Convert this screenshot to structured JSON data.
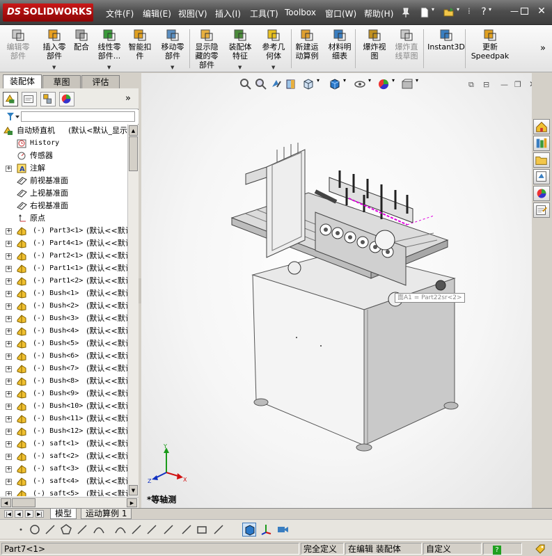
{
  "app": {
    "logo": "SOLIDWORKS",
    "logo_prefix": "DS"
  },
  "menu": [
    "文件(F)",
    "编辑(E)",
    "视图(V)",
    "插入(I)",
    "工具(T)",
    "Toolbox",
    "窗口(W)",
    "帮助(H)"
  ],
  "command_manager": {
    "commands": [
      {
        "label_lines": [
          "编辑零",
          "部件"
        ],
        "disabled": true,
        "icon": "edit-component-icon"
      },
      {
        "label_lines": [
          "插入零",
          "部件"
        ],
        "disabled": false,
        "icon": "insert-component-icon"
      },
      {
        "label_lines": [
          "配合"
        ],
        "disabled": false,
        "icon": "mate-icon"
      },
      {
        "label_lines": [
          "线性零",
          "部件..."
        ],
        "disabled": false,
        "icon": "linear-pattern-icon"
      },
      {
        "label_lines": [
          "智能扣",
          "件"
        ],
        "disabled": false,
        "icon": "smart-fasteners-icon"
      },
      {
        "label_lines": [
          "移动零",
          "部件"
        ],
        "disabled": false,
        "icon": "move-component-icon"
      },
      {
        "label_lines": [
          "显示隐",
          "藏的零",
          "部件"
        ],
        "disabled": false,
        "icon": "show-hidden-icon"
      },
      {
        "label_lines": [
          "装配体",
          "特征"
        ],
        "disabled": false,
        "icon": "assembly-features-icon"
      },
      {
        "label_lines": [
          "参考几",
          "何体"
        ],
        "disabled": false,
        "icon": "reference-geometry-icon"
      },
      {
        "label_lines": [
          "新建运",
          "动算例"
        ],
        "disabled": false,
        "icon": "new-motion-study-icon"
      },
      {
        "label_lines": [
          "材料明",
          "细表"
        ],
        "disabled": false,
        "icon": "bom-icon"
      },
      {
        "label_lines": [
          "爆炸视",
          "图"
        ],
        "disabled": false,
        "icon": "exploded-view-icon"
      },
      {
        "label_lines": [
          "爆炸直",
          "线草图"
        ],
        "disabled": true,
        "icon": "explode-line-sketch-icon"
      },
      {
        "label_lines": [
          "Instant3D"
        ],
        "disabled": false,
        "icon": "instant3d-icon"
      },
      {
        "label_lines": [
          "更新",
          "Speedpak"
        ],
        "disabled": false,
        "icon": "speedpak-icon"
      }
    ],
    "more": "»"
  },
  "left_pane": {
    "tabs": [
      "装配体",
      "草图",
      "评估"
    ],
    "active_tab": "装配体",
    "expand_arrow": "»"
  },
  "tree": {
    "root": {
      "name": "自动矫直机",
      "config": "(默认<默认_显示"
    },
    "items": [
      {
        "name": "History",
        "type": "history",
        "expand": false
      },
      {
        "name": "传感器",
        "type": "sensor",
        "expand": false
      },
      {
        "name": "注解",
        "type": "annotation",
        "expand": true
      },
      {
        "name": "前视基准面",
        "type": "plane",
        "expand": false
      },
      {
        "name": "上视基准面",
        "type": "plane",
        "expand": false
      },
      {
        "name": "右视基准面",
        "type": "plane",
        "expand": false
      },
      {
        "name": "原点",
        "type": "origin",
        "expand": false
      },
      {
        "name": "(-) Part3<1>",
        "config": "(默认<<默认",
        "type": "part"
      },
      {
        "name": "(-) Part4<1>",
        "config": "(默认<<默认",
        "type": "part"
      },
      {
        "name": "(-) Part2<1>",
        "config": "(默认<<默认",
        "type": "part"
      },
      {
        "name": "(-) Part1<1>",
        "config": "(默认<<默认",
        "type": "part"
      },
      {
        "name": "(-) Part1<2>",
        "config": "(默认<<默认",
        "type": "part"
      },
      {
        "name": "(-) Bush<1>",
        "config": "(默认<<默认",
        "type": "part"
      },
      {
        "name": "(-) Bush<2>",
        "config": "(默认<<默认",
        "type": "part"
      },
      {
        "name": "(-) Bush<3>",
        "config": "(默认<<默认",
        "type": "part"
      },
      {
        "name": "(-) Bush<4>",
        "config": "(默认<<默认",
        "type": "part"
      },
      {
        "name": "(-) Bush<5>",
        "config": "(默认<<默认",
        "type": "part"
      },
      {
        "name": "(-) Bush<6>",
        "config": "(默认<<默认",
        "type": "part"
      },
      {
        "name": "(-) Bush<7>",
        "config": "(默认<<默认",
        "type": "part"
      },
      {
        "name": "(-) Bush<8>",
        "config": "(默认<<默认",
        "type": "part"
      },
      {
        "name": "(-) Bush<9>",
        "config": "(默认<<默认",
        "type": "part"
      },
      {
        "name": "(-) Bush<10>",
        "config": "(默认<<默认",
        "type": "part"
      },
      {
        "name": "(-) Bush<11>",
        "config": "(默认<<默认",
        "type": "part"
      },
      {
        "name": "(-) Bush<12>",
        "config": "(默认<<默认",
        "type": "part"
      },
      {
        "name": "(-) saft<1>",
        "config": "(默认<<默认",
        "type": "part"
      },
      {
        "name": "(-) saft<2>",
        "config": "(默认<<默认",
        "type": "part"
      },
      {
        "name": "(-) saft<3>",
        "config": "(默认<<默认",
        "type": "part"
      },
      {
        "name": "(-) saft<4>",
        "config": "(默认<<默认",
        "type": "part"
      },
      {
        "name": "(-) saft<5>",
        "config": "(默认<<默认",
        "type": "part"
      }
    ]
  },
  "graphics": {
    "view_name": "*等轴测",
    "tooltip": "面A1 = Part22sr<2>",
    "triad_labels": {
      "x": "X",
      "y": "Y",
      "z": "Z"
    }
  },
  "bottom_tabs": [
    "模型",
    "运动算例 1"
  ],
  "active_bottom_tab": "模型",
  "status": {
    "selection": "Part7<1>",
    "fully_defined": "完全定义",
    "editing": "在编辑 装配体",
    "units": "自定义",
    "help": "?"
  },
  "colors": {
    "menubar": "#4e4e4e",
    "logo_red": "#c91818",
    "selection_magenta": "#e000e0"
  }
}
